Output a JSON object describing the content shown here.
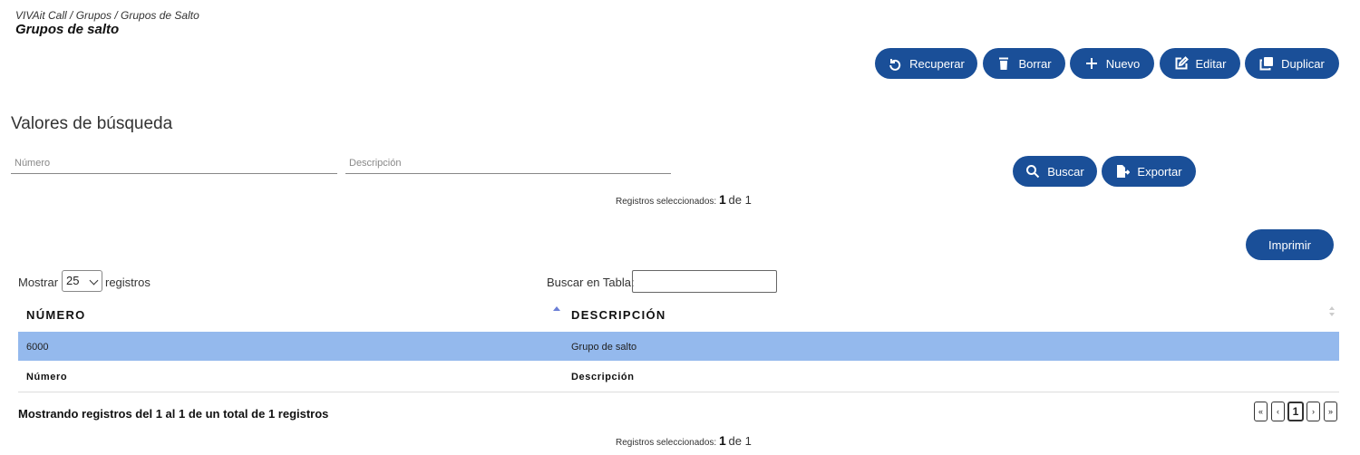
{
  "breadcrumb": "VIVAit Call / Grupos / Grupos de Salto",
  "title": "Grupos de salto",
  "toolbar": {
    "recuperar": "Recuperar",
    "borrar": "Borrar",
    "nuevo": "Nuevo",
    "editar": "Editar",
    "duplicar": "Duplicar"
  },
  "search": {
    "heading": "Valores de búsqueda",
    "numero_placeholder": "Número",
    "descripcion_placeholder": "Descripción",
    "buscar": "Buscar",
    "exportar": "Exportar"
  },
  "selected": {
    "label": "Registros seleccionados:",
    "count": "1",
    "of": "de 1"
  },
  "imprimir": "Imprimir",
  "table": {
    "show_label": "Mostrar",
    "page_size": "25",
    "records_label": "registros",
    "search_label": "Buscar en Tabla:",
    "col_numero": "NÚMERO",
    "col_descripcion": "DESCRIPCIÓN",
    "rows": [
      {
        "numero": "6000",
        "descripcion": "Grupo de salto"
      }
    ],
    "foot_numero": "Número",
    "foot_descripcion": "Descripción",
    "summary": "Mostrando registros del 1 al 1 de un total de 1 registros",
    "pagination": [
      "«",
      "‹",
      "1",
      "›",
      "»"
    ]
  }
}
